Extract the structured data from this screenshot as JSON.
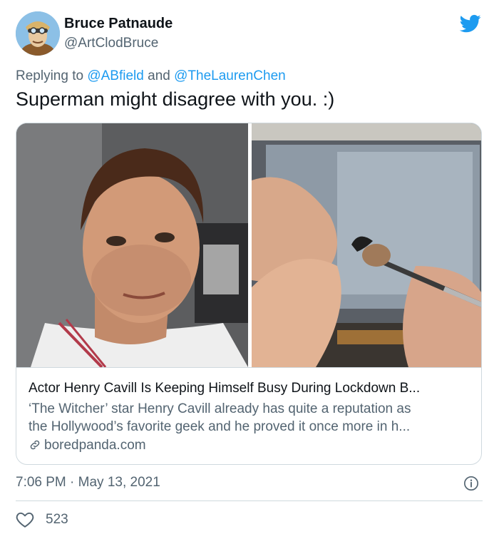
{
  "author": {
    "name": "Bruce Patnaude",
    "handle": "@ArtClodBruce",
    "avatar_icon": "avatar-illustration"
  },
  "brand_icon": "twitter-bird-icon",
  "reply": {
    "prefix": "Replying to",
    "mention1": "@ABfield",
    "joiner": "and",
    "mention2": "@TheLaurenChen"
  },
  "tweet": {
    "text": "Superman might disagree with you. :)"
  },
  "card": {
    "title": "Actor Henry Cavill Is Keeping Himself Busy During Lockdown B...",
    "description_line1": "‘The Witcher’ star Henry Cavill already has quite a reputation as",
    "description_line2": "the Hollywood’s favorite geek and he proved it once more in h...",
    "domain": "boredpanda.com",
    "left_image": "man-portrait-photo",
    "right_image": "painting-miniature-photo"
  },
  "meta": {
    "time": "7:06 PM",
    "separator": "·",
    "date": "May 13, 2021"
  },
  "engagement": {
    "likes": "523"
  },
  "colors": {
    "link": "#1d9bf0",
    "secondary_text": "#536471",
    "border": "#cfd9de"
  }
}
